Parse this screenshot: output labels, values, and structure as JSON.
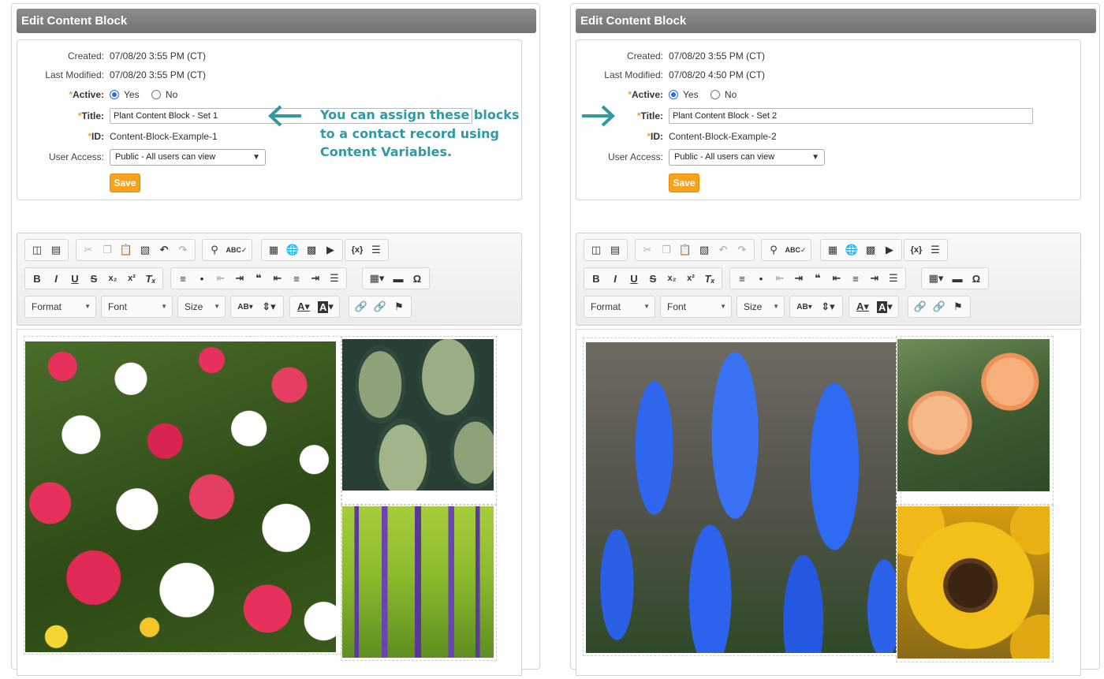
{
  "annotation": {
    "callout_line1": "You can assign these blocks",
    "callout_line2": "to a contact record using",
    "callout_line3": "Content Variables."
  },
  "labels": {
    "created": "Created:",
    "last_modified": "Last Modified:",
    "active": "Active:",
    "title": "Title:",
    "id": "ID:",
    "user_access": "User Access:",
    "required_marker": "*",
    "yes": "Yes",
    "no": "No",
    "save": "Save"
  },
  "toolbar": {
    "format": "Format",
    "font": "Font",
    "size": "Size"
  },
  "accent_colors": {
    "save_button": "#f6a21a",
    "callout": "#2f9aa2",
    "titlebar": "#808080"
  },
  "panels": [
    {
      "header": "Edit Content Block",
      "created": "07/08/20 3:55 PM (CT)",
      "last_modified": "07/08/20 3:55 PM (CT)",
      "active": "Yes",
      "title_value": "Plant Content Block - Set 1",
      "id_value": "Content-Block-Example-1",
      "user_access": "Public - All users can view"
    },
    {
      "header": "Edit Content Block",
      "created": "07/08/20 3:55 PM (CT)",
      "last_modified": "07/08/20 4:50 PM (CT)",
      "active": "Yes",
      "title_value": "Plant Content Block - Set 2",
      "id_value": "Content-Block-Example-2",
      "user_access": "Public - All users can view"
    }
  ]
}
